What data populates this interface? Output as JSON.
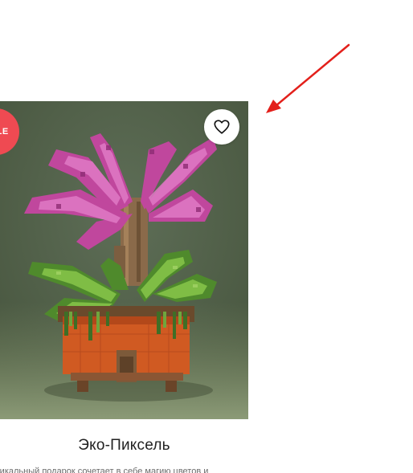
{
  "product": {
    "badge": "SALE",
    "title": "Эко-Пиксель",
    "description": "т уникальный подарок сочетает в себе магию цветов и",
    "wishlist_icon": "heart-outline-icon",
    "image_alt": "Пиксельное растение в горшке"
  },
  "colors": {
    "badge_bg": "#ef4a52",
    "arrow": "#e3201b",
    "title": "#222222",
    "description": "#6a6a6a"
  }
}
